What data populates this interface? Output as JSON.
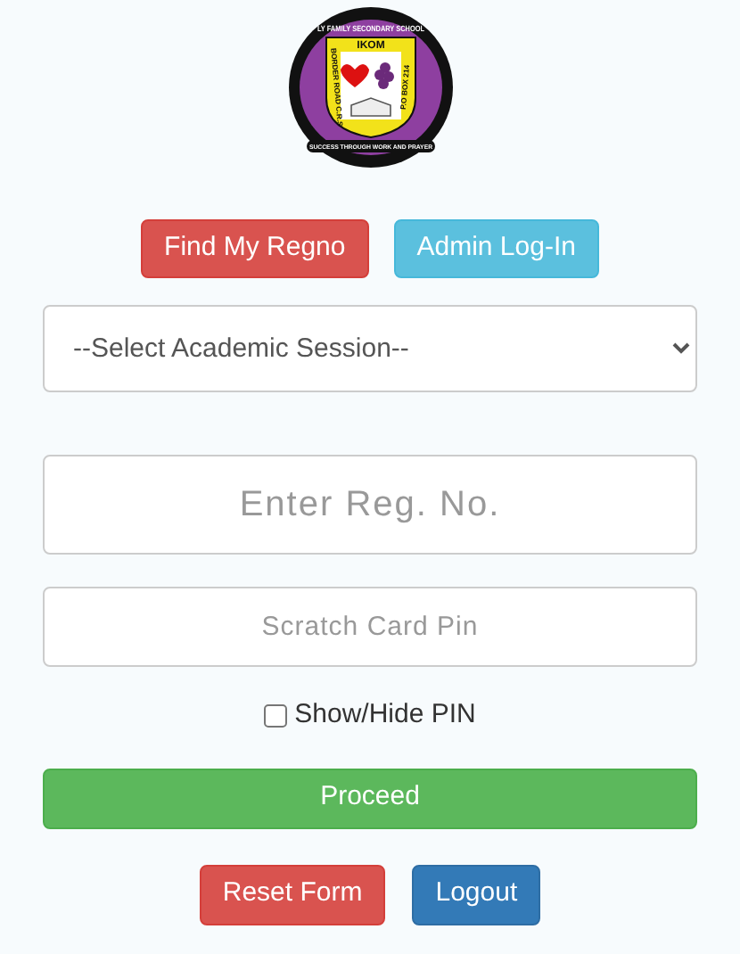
{
  "logo": {
    "top_text": "LY FAMILY SECONDARY SCHOOL",
    "town": "IKOM",
    "left_text": "BORDER ROAD C.R.S",
    "right_text": "P.O BOX 214",
    "motto": "SUCCESS THROUGH WORK AND PRAYER"
  },
  "top_buttons": [
    {
      "label": "Find My Regno",
      "kind": "danger"
    },
    {
      "label": "Admin Log-In",
      "kind": "info"
    }
  ],
  "session_select": {
    "value": "--Select Academic Session--"
  },
  "reg_field": {
    "placeholder": "Enter Reg. No."
  },
  "pin_field": {
    "placeholder": "Scratch Card Pin"
  },
  "show_pin": {
    "label": "Show/Hide PIN",
    "checked": false
  },
  "proceed_button": {
    "label": "Proceed"
  },
  "bottom_buttons": [
    {
      "label": "Reset Form",
      "kind": "danger"
    },
    {
      "label": "Logout",
      "kind": "primary"
    }
  ]
}
